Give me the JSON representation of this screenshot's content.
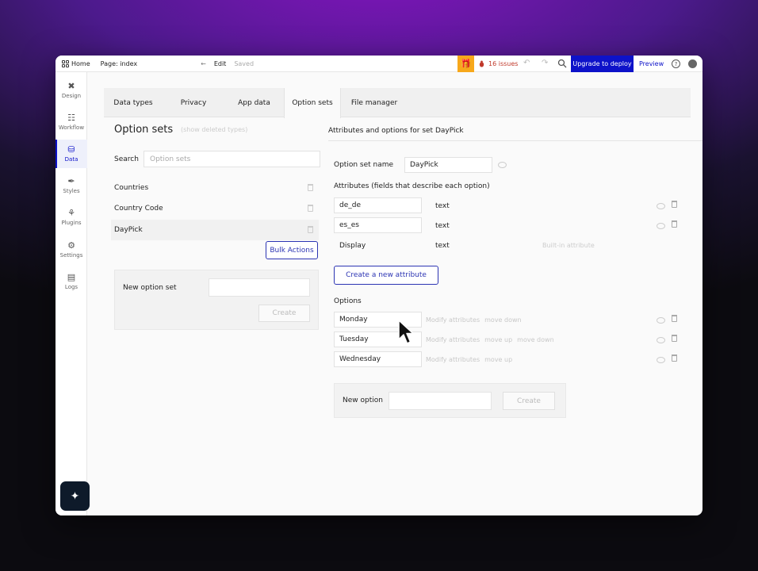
{
  "topbar": {
    "home_label": "Home",
    "page_label": "Page: index",
    "back_arrow": "←",
    "edit_label": "Edit",
    "saved_label": "Saved",
    "issues_label": "16 issues",
    "upgrade_label": "Upgrade to deploy",
    "preview_label": "Preview",
    "help_label": "?"
  },
  "sidebar": {
    "items": [
      {
        "label": "Design",
        "icon": "design-icon"
      },
      {
        "label": "Workflow",
        "icon": "workflow-icon"
      },
      {
        "label": "Data",
        "icon": "data-icon"
      },
      {
        "label": "Styles",
        "icon": "styles-icon"
      },
      {
        "label": "Plugins",
        "icon": "plugins-icon"
      },
      {
        "label": "Settings",
        "icon": "settings-icon"
      },
      {
        "label": "Logs",
        "icon": "logs-icon"
      }
    ],
    "active": "Data"
  },
  "tabs": [
    {
      "label": "Data types"
    },
    {
      "label": "Privacy"
    },
    {
      "label": "App data"
    },
    {
      "label": "Option sets"
    },
    {
      "label": "File manager"
    }
  ],
  "active_tab": "Option sets",
  "left": {
    "title": "Option sets",
    "show_deleted": "(show deleted types)",
    "search_label": "Search",
    "search_placeholder": "Option sets",
    "option_sets": [
      {
        "name": "Countries"
      },
      {
        "name": "Country Code"
      },
      {
        "name": "DayPick"
      }
    ],
    "selected": "DayPick",
    "bulk_actions_label": "Bulk Actions",
    "new_option_set_label": "New option set",
    "create_label": "Create"
  },
  "right": {
    "header": "Attributes and options for set DayPick",
    "option_set_name_label": "Option set name",
    "option_set_name_value": "DayPick",
    "attributes_title": "Attributes (fields that describe each option)",
    "attributes": [
      {
        "name": "de_de",
        "type": "text",
        "note": ""
      },
      {
        "name": "es_es",
        "type": "text",
        "note": ""
      },
      {
        "name": "Display",
        "type": "text",
        "note": "Built-in attribute"
      }
    ],
    "create_attribute_label": "Create a new attribute",
    "options_title": "Options",
    "options": [
      {
        "name": "Monday",
        "actions": [
          "Modify attributes",
          "move down"
        ]
      },
      {
        "name": "Tuesday",
        "actions": [
          "Modify attributes",
          "move up",
          "move down"
        ]
      },
      {
        "name": "Wednesday",
        "actions": [
          "Modify attributes",
          "move up"
        ]
      }
    ],
    "new_option_label": "New option",
    "create_label": "Create"
  },
  "colors": {
    "accent": "#0d12c9",
    "warning": "#f7a81b",
    "issues": "#c0392b"
  }
}
